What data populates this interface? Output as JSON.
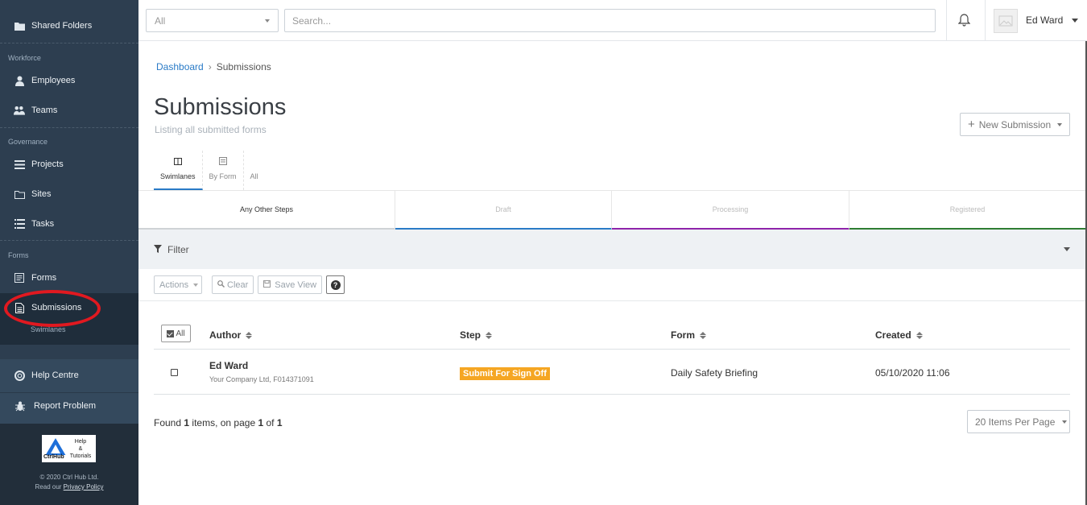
{
  "sidebar": {
    "items": [
      {
        "label": "Shared Folders",
        "icon": "folder-icon"
      },
      {
        "label": "Employees",
        "icon": "user-icon"
      },
      {
        "label": "Teams",
        "icon": "users-icon"
      },
      {
        "label": "Projects",
        "icon": "list-icon"
      },
      {
        "label": "Sites",
        "icon": "folder-outline-icon"
      },
      {
        "label": "Tasks",
        "icon": "tasks-icon"
      },
      {
        "label": "Forms",
        "icon": "form-icon"
      },
      {
        "label": "Submissions",
        "icon": "document-icon"
      }
    ],
    "sections": {
      "workforce": "Workforce",
      "governance": "Governance",
      "forms": "Forms"
    },
    "sub_item": "Swimlanes",
    "help": {
      "label": "Help Centre",
      "icon": "lifebuoy-icon"
    },
    "report": {
      "label": "Report Problem",
      "icon": "bug-icon"
    },
    "logo": {
      "brand": "CtrlHub",
      "line1": "Help",
      "line2": "&",
      "line3": "Tutorials"
    },
    "copyright": "© 2020 Ctrl Hub Ltd.",
    "read_our": "Read our",
    "privacy": "Privacy Policy"
  },
  "topbar": {
    "scope_value": "All",
    "search_placeholder": "Search...",
    "user_name": "Ed Ward"
  },
  "breadcrumb": {
    "root": "Dashboard",
    "sep": "›",
    "current": "Submissions"
  },
  "page": {
    "title": "Submissions",
    "subtitle": "Listing all submitted forms",
    "new_button": "New Submission"
  },
  "tabs": [
    {
      "label": "Swimlanes"
    },
    {
      "label": "By Form"
    },
    {
      "label": "All"
    }
  ],
  "steps": [
    {
      "label": "Any Other Steps",
      "color": "#cfd3d6"
    },
    {
      "label": "Draft",
      "color": "#2a7bc7"
    },
    {
      "label": "Processing",
      "color": "#8e24aa"
    },
    {
      "label": "Registered",
      "color": "#2e7d32"
    }
  ],
  "filter": {
    "label": "Filter"
  },
  "actions": {
    "actions": "Actions",
    "clear": "Clear",
    "save_view": "Save View",
    "help": "?"
  },
  "table": {
    "select_all": "All",
    "headers": {
      "author": "Author",
      "step": "Step",
      "form": "Form",
      "created": "Created"
    },
    "rows": [
      {
        "author": "Ed Ward",
        "author_sub": "Your Company Ltd, F014371091",
        "step": "Submit For Sign Off",
        "form": "Daily Safety Briefing",
        "created": "05/10/2020 11:06"
      }
    ]
  },
  "pagination": {
    "found_prefix": "Found",
    "found_count": "1",
    "found_mid": "items, on page",
    "page": "1",
    "of": "of",
    "total_pages": "1",
    "per_page": "20 Items Per Page"
  },
  "colors": {
    "sidebar": "#2d3e50",
    "accent": "#2a7bc7",
    "badge": "#f5a623",
    "annotation": "#e11920"
  }
}
